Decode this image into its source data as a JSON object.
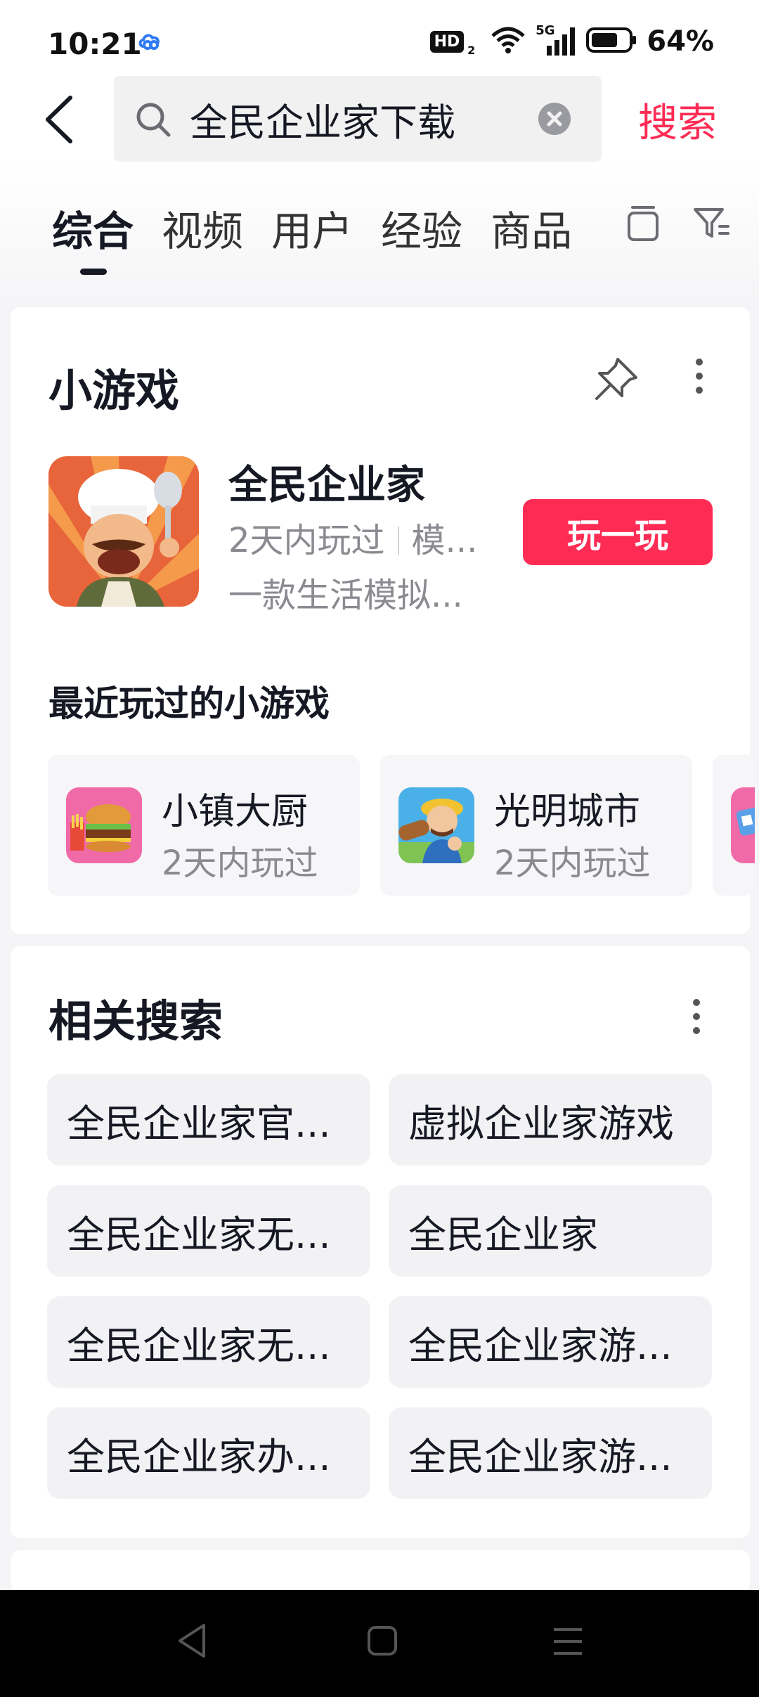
{
  "status_bar": {
    "time": "10:21",
    "hd_label": "HD",
    "hd_sub": "2",
    "network": "5G",
    "battery": "64%"
  },
  "search": {
    "query": "全民企业家下载",
    "button_label": "搜索"
  },
  "tabs": [
    {
      "label": "综合",
      "active": true
    },
    {
      "label": "视频",
      "active": false
    },
    {
      "label": "用户",
      "active": false
    },
    {
      "label": "经验",
      "active": false
    },
    {
      "label": "商品",
      "active": false
    }
  ],
  "mini_game": {
    "section_title": "小游戏",
    "game_name": "全民企业家",
    "played": "2天内玩过",
    "genre": "模...",
    "description": "一款生活模拟...",
    "play_button": "玩一玩",
    "recent_title": "最近玩过的小游戏",
    "recent": [
      {
        "name": "小镇大厨",
        "time": "2天内玩过"
      },
      {
        "name": "光明城市",
        "time": "2天内玩过"
      }
    ]
  },
  "related": {
    "section_title": "相关搜索",
    "items": [
      "全民企业家官...",
      "虚拟企业家游戏",
      "全民企业家无...",
      "全民企业家",
      "全民企业家无...",
      "全民企业家游...",
      "全民企业家办...",
      "全民企业家游..."
    ]
  },
  "colors": {
    "accent": "#fe2c55",
    "text": "#161823",
    "secondary_text": "#8a8b91"
  }
}
